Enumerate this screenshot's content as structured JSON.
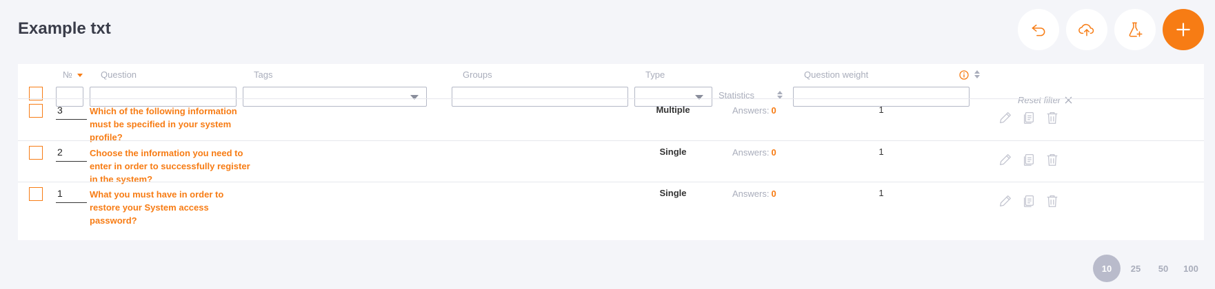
{
  "page": {
    "title": "Example txt"
  },
  "toolbar": {
    "accent": "#f77c14",
    "buttons": [
      {
        "name": "back",
        "icon": "undo-arrow-icon"
      },
      {
        "name": "upload",
        "icon": "cloud-upload-icon"
      },
      {
        "name": "test-flask",
        "icon": "flask-add-icon"
      },
      {
        "name": "add",
        "icon": "plus-icon"
      }
    ]
  },
  "table": {
    "headers": {
      "number": "№",
      "question": "Question",
      "tags": "Tags",
      "groups": "Groups",
      "type": "Type",
      "statistics": "Statistics",
      "weight": "Question weight"
    },
    "reset_filter": "Reset filter",
    "rows": [
      {
        "number": "3",
        "question": "Which of the following information must be specified in your system profile?",
        "type": "Multiple",
        "answers_label": "Answers:",
        "answers_count": "0",
        "weight": "1"
      },
      {
        "number": "2",
        "question": "Choose the information you need to enter in order to successfully register in the system?",
        "type": "Single",
        "answers_label": "Answers:",
        "answers_count": "0",
        "weight": "1"
      },
      {
        "number": "1",
        "question": "What you must have in order to restore your System access password?",
        "type": "Single",
        "answers_label": "Answers:",
        "answers_count": "0",
        "weight": "1"
      }
    ]
  },
  "pagination": {
    "options": [
      "10",
      "25",
      "50",
      "100"
    ],
    "active": "10"
  }
}
